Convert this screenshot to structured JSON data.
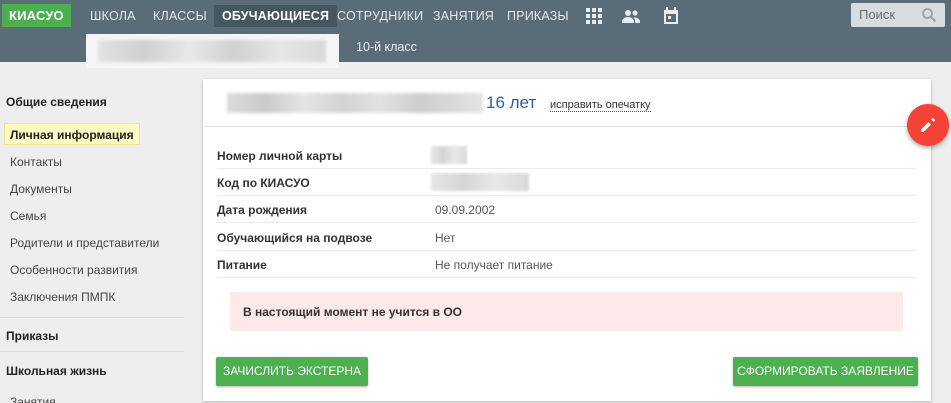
{
  "navbar": {
    "brand": "КИАСУО",
    "items": [
      "ШКОЛА",
      "КЛАССЫ",
      "ОБУЧАЮЩИЕСЯ",
      "СОТРУДНИКИ",
      "ЗАНЯТИЯ",
      "ПРИКАЗЫ"
    ],
    "icons": [
      "apps-grid-icon",
      "people-icon",
      "calendar-icon"
    ],
    "search_placeholder": "Поиск"
  },
  "subheader": {
    "class_label": "10-й класс"
  },
  "sidebar": {
    "general_heading": "Общие сведения",
    "active_item": "Личная информация",
    "items": [
      "Контакты",
      "Документы",
      "Семья",
      "Родители и представители",
      "Особенности развития",
      "Заключения ПМПК"
    ],
    "orders_heading": "Приказы",
    "school_life_heading": "Школьная жизнь",
    "school_life_items": [
      "Занятия"
    ]
  },
  "card": {
    "age": "16 лет",
    "fix_link": "исправить опечатку",
    "rows": [
      {
        "label": "Номер личной карты",
        "value": ""
      },
      {
        "label": "Код по КИАСУО",
        "value": ""
      },
      {
        "label": "Дата рождения",
        "value": "09.09.2002"
      },
      {
        "label": "Обучающийся на подвозе",
        "value": "Нет"
      },
      {
        "label": "Питание",
        "value": "Не получает питание"
      }
    ],
    "alert": "В настоящий момент не учится в ОО",
    "enroll_button": "ЗАЧИСЛИТЬ ЭКСТЕРНА",
    "application_button": "СФОРМИРОВАТЬ ЗАЯВЛЕНИЕ"
  },
  "colors": {
    "navbar": "#5a6c78",
    "brand": "#4caf50",
    "button": "#4caf50",
    "fab": "#f44336",
    "alert_bg": "#fde8ea",
    "age_text": "#2f5f9e"
  },
  "fab_icon": "pencil-icon"
}
